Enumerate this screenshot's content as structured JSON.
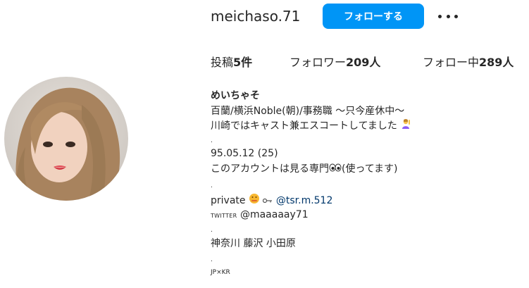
{
  "profile": {
    "username": "meichaso.71",
    "follow_label": "フォローする",
    "more_icon": "more-horizontal-icon"
  },
  "stats": {
    "posts_label": "投稿",
    "posts_count": "5件",
    "followers_label": "フォロワー",
    "followers_count": "209人",
    "following_label": "フォロー中",
    "following_count": "289人"
  },
  "bio": {
    "display_name": "めいちゃそ",
    "line1": "百蘭/横浜Noble(朝)/事務職 ～只今産休中～",
    "line2": "川崎ではキャスト兼エスコートしてました",
    "dot1": ".",
    "birthday": "95.05.12 (25)",
    "line_watch_a": "このアカウントは見る専門",
    "line_watch_b": "(使ってます)",
    "dot2": ".",
    "private_label": "private",
    "private_handle": "@tsr.m.512",
    "twitter_label": "TWITTER",
    "twitter_handle": "@maaaaay71",
    "dot3": ".",
    "location": "神奈川 藤沢 小田原",
    "dot4": ".",
    "footer": "JP×KR"
  },
  "colors": {
    "accent": "#0095f6",
    "link": "#00376b",
    "text": "#262626"
  }
}
